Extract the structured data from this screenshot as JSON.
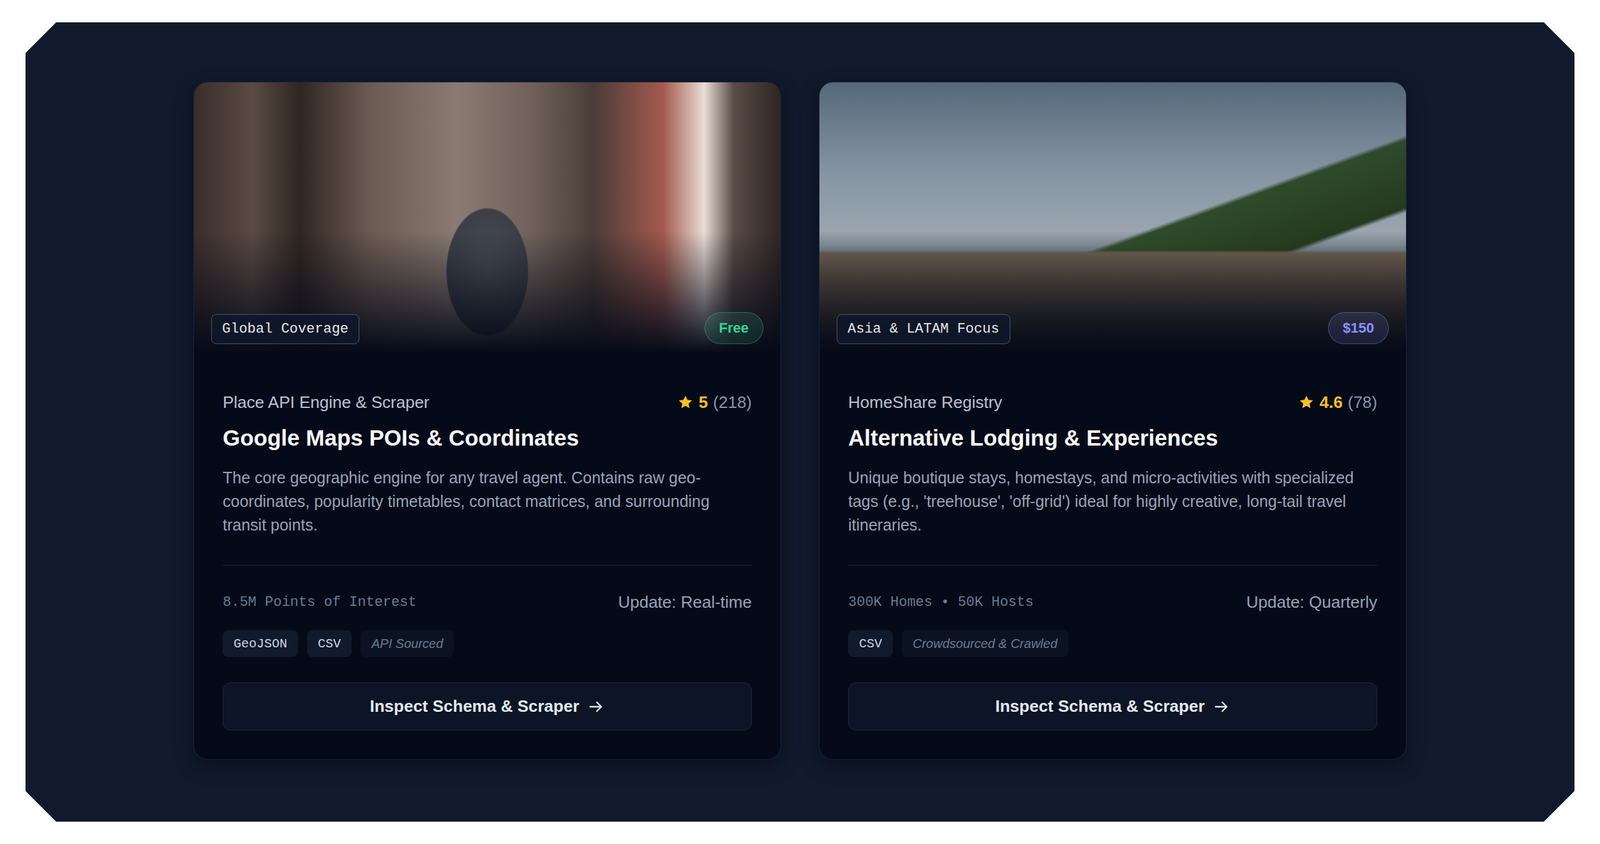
{
  "cards": [
    {
      "region": "Global Coverage",
      "price": "Free",
      "color": "#34d399",
      "provider": "Place API Engine & Scraper",
      "rating": "5",
      "reviews": "(218)",
      "title": "Google Maps POIs & Coordinates",
      "description": "The core geographic engine for any travel agent. Contains raw geo-coordinates, popularity timetables, contact matrices, and surrounding transit points.",
      "stats": "8.5M Points of Interest",
      "update": "Update: Real-time",
      "tags": [
        {
          "label": "GeoJSON",
          "kind": "format"
        },
        {
          "label": "CSV",
          "kind": "format"
        },
        {
          "label": "API Sourced",
          "kind": "source"
        }
      ],
      "button": "Inspect Schema & Scraper"
    },
    {
      "region": "Asia & LATAM Focus",
      "price": "$150",
      "color": "#8b93ff",
      "provider": "HomeShare Registry",
      "rating": "4.6",
      "reviews": "(78)",
      "title": "Alternative Lodging & Experiences",
      "description": "Unique boutique stays, homestays, and micro-activities with specialized tags (e.g., 'treehouse', 'off-grid') ideal for highly creative, long-tail travel itineraries.",
      "stats": "300K Homes • 50K Hosts",
      "update": "Update: Quarterly",
      "tags": [
        {
          "label": "CSV",
          "kind": "format"
        },
        {
          "label": "Crowdsourced & Crawled",
          "kind": "source"
        }
      ],
      "button": "Inspect Schema & Scraper"
    }
  ]
}
